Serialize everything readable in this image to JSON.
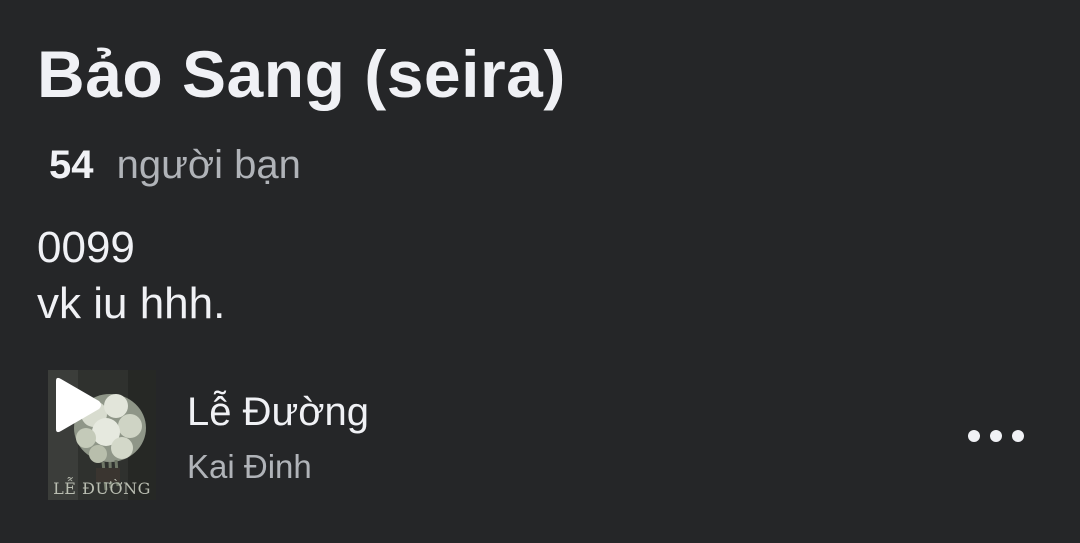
{
  "profile": {
    "name": "Bảo Sang (seira)",
    "friends_count": "54",
    "friends_label": "người bạn",
    "bio_lines": [
      "0099",
      "vk iu hhh."
    ]
  },
  "music": {
    "title": "Lễ Đường",
    "artist": "Kai Đinh",
    "album_art_text": "LỄ ĐƯỜNG",
    "play_icon": "play-icon",
    "more_icon": "more-horizontal-icon"
  },
  "colors": {
    "background": "#252628",
    "primary_text": "#f0f1f5",
    "secondary_text": "#b0b3b8"
  }
}
